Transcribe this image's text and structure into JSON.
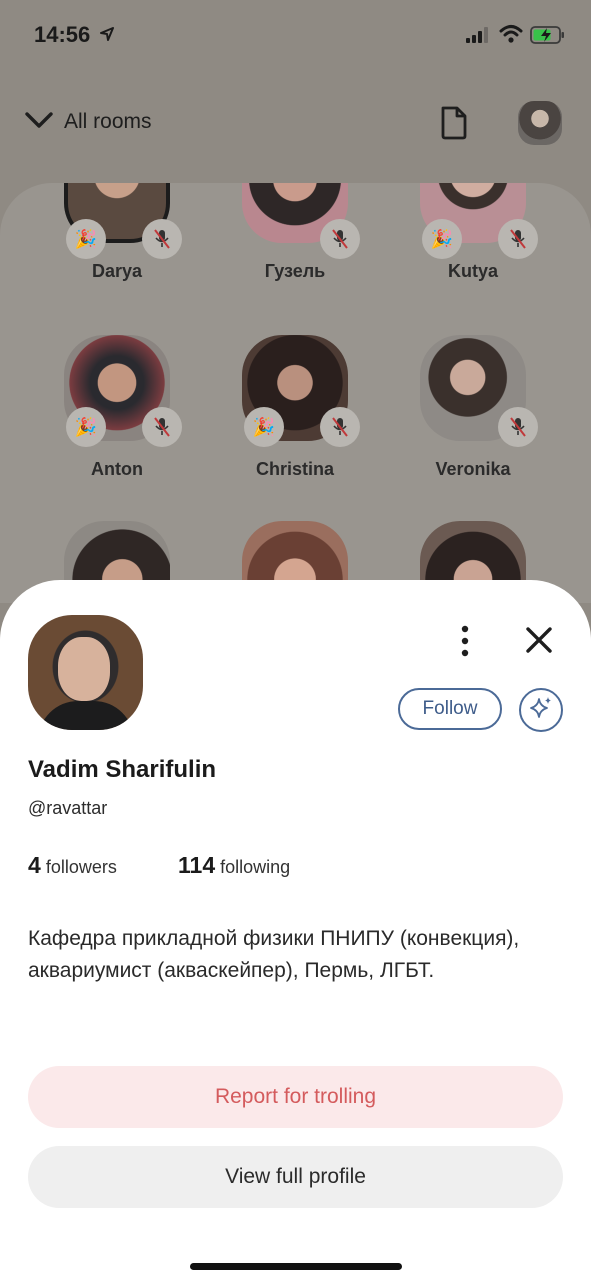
{
  "status_bar": {
    "time": "14:56",
    "icons": [
      "location-arrow-icon",
      "signal-icon",
      "wifi-icon",
      "battery-charging-icon"
    ]
  },
  "header": {
    "rooms_label": "All rooms",
    "icons": [
      "chevron-down-icon",
      "document-icon",
      "avatar"
    ]
  },
  "room": {
    "speakers": [
      {
        "name": "Darya",
        "party": true,
        "muted": true,
        "photo_color": "#8a6a5a"
      },
      {
        "name": "Гузель",
        "party": false,
        "muted": true,
        "photo_color": "#c98a93"
      },
      {
        "name": "Kutya",
        "party": true,
        "muted": true,
        "photo_color": "#c7a5a8"
      },
      {
        "name": "Anton",
        "party": true,
        "muted": true,
        "photo_color": "#6f5f57"
      },
      {
        "name": "Christina",
        "party": true,
        "muted": true,
        "photo_color": "#4b3b35"
      },
      {
        "name": "Veronika",
        "party": false,
        "muted": true,
        "photo_color": "#8e8a86"
      },
      {
        "name": "",
        "party": false,
        "muted": false,
        "photo_color": "#5e514a"
      },
      {
        "name": "",
        "party": false,
        "muted": false,
        "photo_color": "#9a6e5e"
      },
      {
        "name": "",
        "party": false,
        "muted": false,
        "photo_color": "#6b5a52"
      }
    ]
  },
  "profile": {
    "name": "Vadim Sharifulin",
    "handle": "@ravattar",
    "followers_count": "4",
    "followers_label": "followers",
    "following_count": "114",
    "following_label": "following",
    "bio": "Кафедра прикладной физики ПНИПУ (конвекция), аквариумист (акваскейпер), Пермь, ЛГБТ.",
    "follow_label": "Follow",
    "report_label": "Report for trolling",
    "view_profile_label": "View full profile"
  },
  "colors": {
    "accent_blue": "#4b6a97",
    "report_text": "#d45b5d",
    "report_bg": "#fbe9ea",
    "overlay_bg": "#8f8a83"
  }
}
